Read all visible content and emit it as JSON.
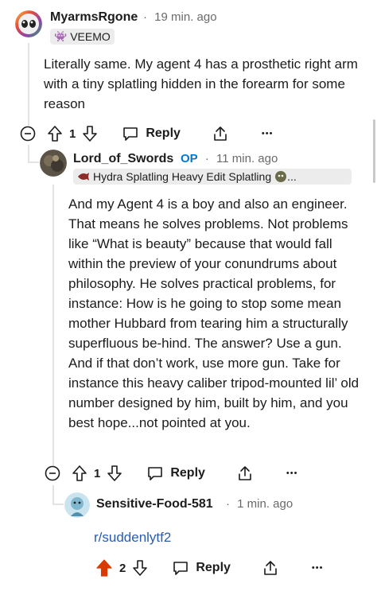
{
  "comments": [
    {
      "username": "MyarmsRgone",
      "time": "19 min. ago",
      "flair": "VEEMO",
      "flair_emoji": "👾",
      "body": "Literally same. My agent 4 has a prosthetic right arm with a tiny splatling hidden in the forearm for some reason",
      "votes": "1",
      "reply_label": "Reply",
      "more_label": "•••"
    },
    {
      "username": "Lord_of_Swords",
      "op_badge": "OP",
      "time": "11 min. ago",
      "flair": "Hydra Splatling  Heavy Edit Splatling",
      "flair_trailing": "...",
      "body": "And my Agent 4 is a boy and also an engineer. That means he solves problems. Not problems like “What is beauty” because that would fall within the preview of your conundrums about philosophy. He solves practical problems, for instance: How is he going to stop some mean mother Hubbard from tearing him a structurally superfluous be-hind. The answer? Use a gun. And if that don’t work, use more gun. Take for instance this heavy caliber tripod-mounted lil’ old number designed by him, built by him, and you best hope...not pointed at you.",
      "votes": "1",
      "reply_label": "Reply",
      "more_label": "•••"
    },
    {
      "username": "Sensitive-Food-581",
      "time": "1 min. ago",
      "body": "r/suddenlytf2",
      "votes": "2",
      "reply_label": "Reply",
      "more_label": "•••"
    }
  ],
  "separator": "·",
  "colors": {
    "upvote_active": "#d93a00",
    "link": "#2a5db0",
    "op": "#0079d3"
  }
}
